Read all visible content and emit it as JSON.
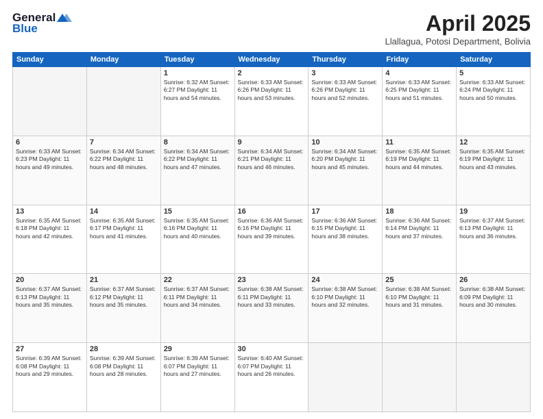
{
  "header": {
    "logo_general": "General",
    "logo_blue": "Blue",
    "title": "April 2025",
    "location": "Llallagua, Potosi Department, Bolivia"
  },
  "days_of_week": [
    "Sunday",
    "Monday",
    "Tuesday",
    "Wednesday",
    "Thursday",
    "Friday",
    "Saturday"
  ],
  "weeks": [
    [
      {
        "day": "",
        "detail": ""
      },
      {
        "day": "",
        "detail": ""
      },
      {
        "day": "1",
        "detail": "Sunrise: 6:32 AM\nSunset: 6:27 PM\nDaylight: 11 hours and 54 minutes."
      },
      {
        "day": "2",
        "detail": "Sunrise: 6:33 AM\nSunset: 6:26 PM\nDaylight: 11 hours and 53 minutes."
      },
      {
        "day": "3",
        "detail": "Sunrise: 6:33 AM\nSunset: 6:26 PM\nDaylight: 11 hours and 52 minutes."
      },
      {
        "day": "4",
        "detail": "Sunrise: 6:33 AM\nSunset: 6:25 PM\nDaylight: 11 hours and 51 minutes."
      },
      {
        "day": "5",
        "detail": "Sunrise: 6:33 AM\nSunset: 6:24 PM\nDaylight: 11 hours and 50 minutes."
      }
    ],
    [
      {
        "day": "6",
        "detail": "Sunrise: 6:33 AM\nSunset: 6:23 PM\nDaylight: 11 hours and 49 minutes."
      },
      {
        "day": "7",
        "detail": "Sunrise: 6:34 AM\nSunset: 6:22 PM\nDaylight: 11 hours and 48 minutes."
      },
      {
        "day": "8",
        "detail": "Sunrise: 6:34 AM\nSunset: 6:22 PM\nDaylight: 11 hours and 47 minutes."
      },
      {
        "day": "9",
        "detail": "Sunrise: 6:34 AM\nSunset: 6:21 PM\nDaylight: 11 hours and 46 minutes."
      },
      {
        "day": "10",
        "detail": "Sunrise: 6:34 AM\nSunset: 6:20 PM\nDaylight: 11 hours and 45 minutes."
      },
      {
        "day": "11",
        "detail": "Sunrise: 6:35 AM\nSunset: 6:19 PM\nDaylight: 11 hours and 44 minutes."
      },
      {
        "day": "12",
        "detail": "Sunrise: 6:35 AM\nSunset: 6:19 PM\nDaylight: 11 hours and 43 minutes."
      }
    ],
    [
      {
        "day": "13",
        "detail": "Sunrise: 6:35 AM\nSunset: 6:18 PM\nDaylight: 11 hours and 42 minutes."
      },
      {
        "day": "14",
        "detail": "Sunrise: 6:35 AM\nSunset: 6:17 PM\nDaylight: 11 hours and 41 minutes."
      },
      {
        "day": "15",
        "detail": "Sunrise: 6:35 AM\nSunset: 6:16 PM\nDaylight: 11 hours and 40 minutes."
      },
      {
        "day": "16",
        "detail": "Sunrise: 6:36 AM\nSunset: 6:16 PM\nDaylight: 11 hours and 39 minutes."
      },
      {
        "day": "17",
        "detail": "Sunrise: 6:36 AM\nSunset: 6:15 PM\nDaylight: 11 hours and 38 minutes."
      },
      {
        "day": "18",
        "detail": "Sunrise: 6:36 AM\nSunset: 6:14 PM\nDaylight: 11 hours and 37 minutes."
      },
      {
        "day": "19",
        "detail": "Sunrise: 6:37 AM\nSunset: 6:13 PM\nDaylight: 11 hours and 36 minutes."
      }
    ],
    [
      {
        "day": "20",
        "detail": "Sunrise: 6:37 AM\nSunset: 6:13 PM\nDaylight: 11 hours and 35 minutes."
      },
      {
        "day": "21",
        "detail": "Sunrise: 6:37 AM\nSunset: 6:12 PM\nDaylight: 11 hours and 35 minutes."
      },
      {
        "day": "22",
        "detail": "Sunrise: 6:37 AM\nSunset: 6:11 PM\nDaylight: 11 hours and 34 minutes."
      },
      {
        "day": "23",
        "detail": "Sunrise: 6:38 AM\nSunset: 6:11 PM\nDaylight: 11 hours and 33 minutes."
      },
      {
        "day": "24",
        "detail": "Sunrise: 6:38 AM\nSunset: 6:10 PM\nDaylight: 11 hours and 32 minutes."
      },
      {
        "day": "25",
        "detail": "Sunrise: 6:38 AM\nSunset: 6:10 PM\nDaylight: 11 hours and 31 minutes."
      },
      {
        "day": "26",
        "detail": "Sunrise: 6:38 AM\nSunset: 6:09 PM\nDaylight: 11 hours and 30 minutes."
      }
    ],
    [
      {
        "day": "27",
        "detail": "Sunrise: 6:39 AM\nSunset: 6:08 PM\nDaylight: 11 hours and 29 minutes."
      },
      {
        "day": "28",
        "detail": "Sunrise: 6:39 AM\nSunset: 6:08 PM\nDaylight: 11 hours and 28 minutes."
      },
      {
        "day": "29",
        "detail": "Sunrise: 6:39 AM\nSunset: 6:07 PM\nDaylight: 11 hours and 27 minutes."
      },
      {
        "day": "30",
        "detail": "Sunrise: 6:40 AM\nSunset: 6:07 PM\nDaylight: 11 hours and 26 minutes."
      },
      {
        "day": "",
        "detail": ""
      },
      {
        "day": "",
        "detail": ""
      },
      {
        "day": "",
        "detail": ""
      }
    ]
  ]
}
